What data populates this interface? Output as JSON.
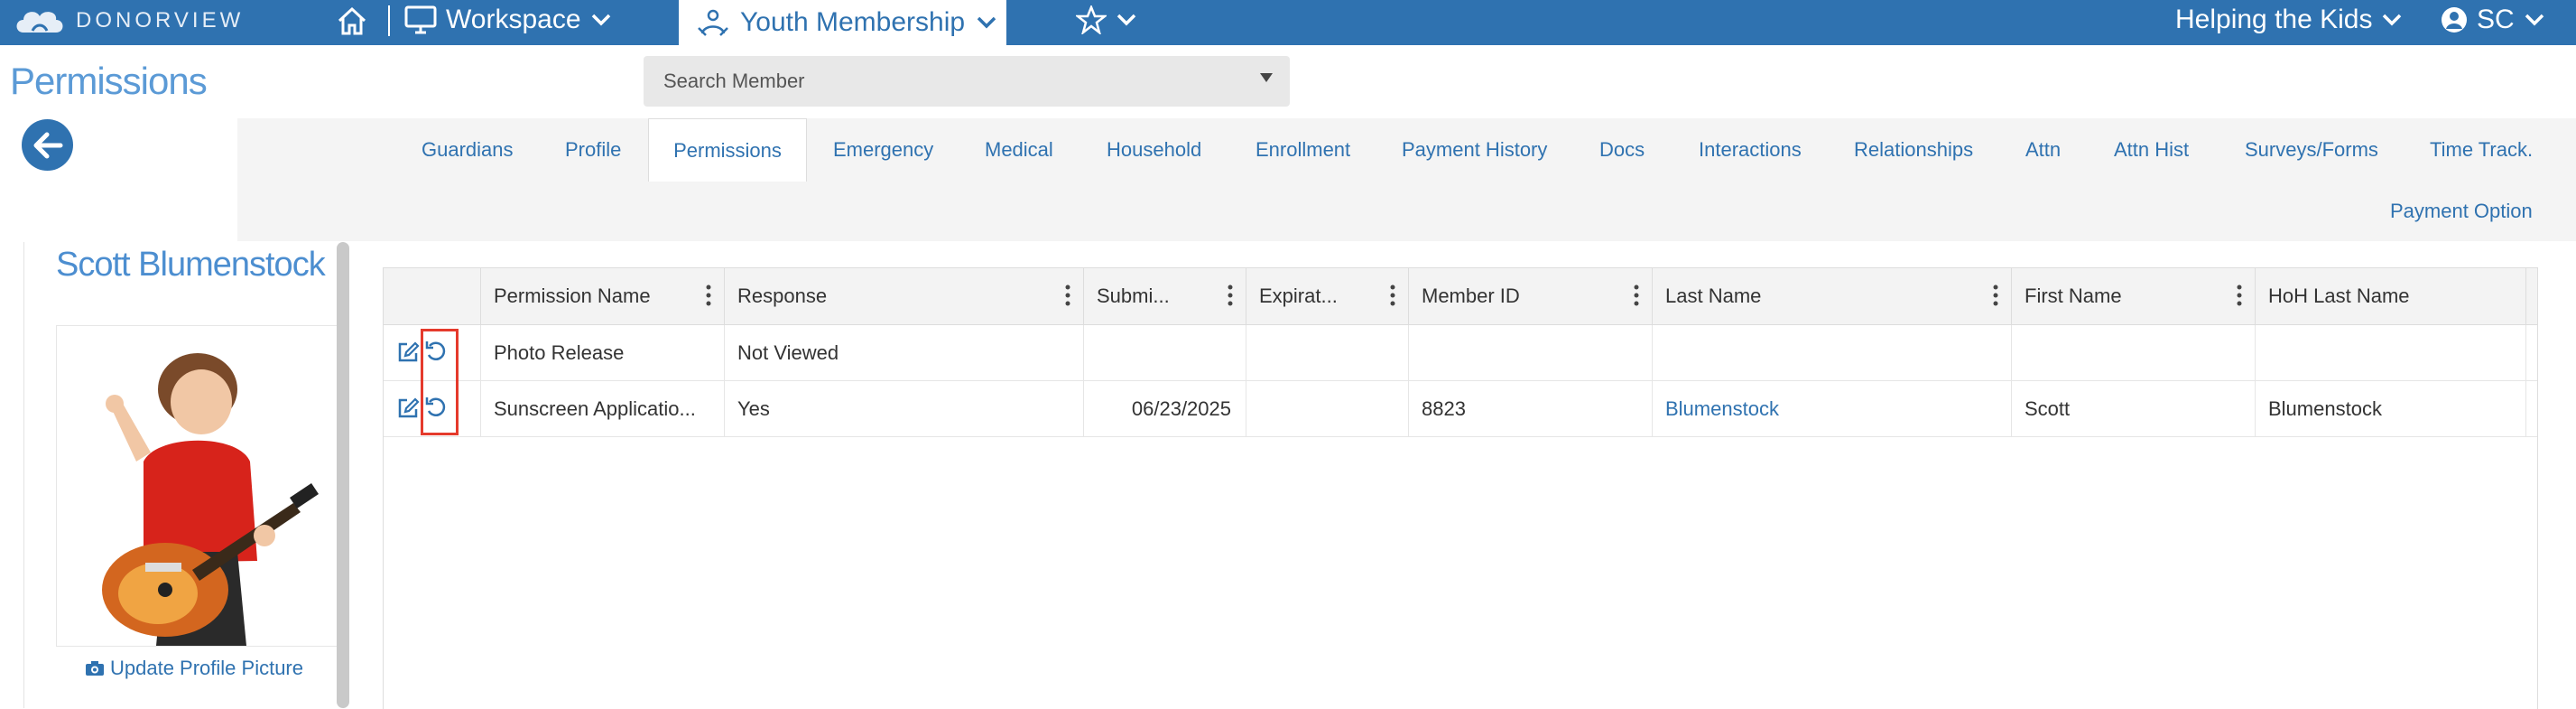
{
  "topbar": {
    "brand": "DONORVIEW",
    "workspace_label": "Workspace",
    "active_module": "Youth Membership",
    "org_label": "Helping the Kids",
    "user_initials": "SC"
  },
  "page": {
    "title": "Permissions",
    "search_placeholder": "Search Member"
  },
  "tabs": [
    {
      "label": "Guardians",
      "active": false
    },
    {
      "label": "Profile",
      "active": false
    },
    {
      "label": "Permissions",
      "active": true
    },
    {
      "label": "Emergency",
      "active": false
    },
    {
      "label": "Medical",
      "active": false
    },
    {
      "label": "Household",
      "active": false
    },
    {
      "label": "Enrollment",
      "active": false
    },
    {
      "label": "Payment History",
      "active": false
    },
    {
      "label": "Docs",
      "active": false
    },
    {
      "label": "Interactions",
      "active": false
    },
    {
      "label": "Relationships",
      "active": false
    },
    {
      "label": "Attn",
      "active": false
    },
    {
      "label": "Attn Hist",
      "active": false
    },
    {
      "label": "Surveys/Forms",
      "active": false
    },
    {
      "label": "Time Track.",
      "active": false
    },
    {
      "label": "Payment Option",
      "active": false
    }
  ],
  "profile": {
    "name": "Scott Blumenstock",
    "update_picture_label": "Update Profile Picture"
  },
  "grid": {
    "columns": [
      "Permission Name",
      "Response",
      "Submi...",
      "Expirat...",
      "Member ID",
      "Last Name",
      "First Name",
      "HoH Last Name"
    ],
    "rows": [
      {
        "permission_name": "Photo Release",
        "response": "Not Viewed",
        "submitted": "",
        "expiration": "",
        "member_id": "",
        "last_name": "",
        "first_name": "",
        "hoh_last_name": ""
      },
      {
        "permission_name": "Sunscreen Applicatio...",
        "response": "Yes",
        "submitted": "06/23/2025",
        "expiration": "",
        "member_id": "8823",
        "last_name": "Blumenstock",
        "first_name": "Scott",
        "hoh_last_name": "Blumenstock"
      }
    ]
  },
  "colors": {
    "brand_blue": "#2f72b0",
    "highlight_red": "#e53a2c"
  }
}
